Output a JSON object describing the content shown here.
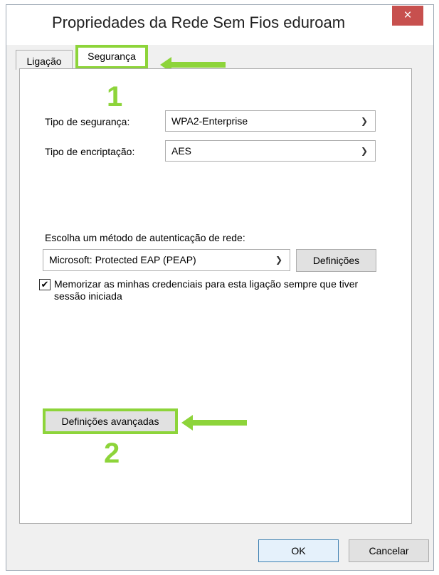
{
  "window": {
    "title": "Propriedades da Rede Sem Fios eduroam",
    "close_symbol": "×"
  },
  "tabs": [
    {
      "label": "Ligação"
    },
    {
      "label": "Segurança"
    }
  ],
  "security_type": {
    "label": "Tipo de segurança:",
    "value": "WPA2-Enterprise"
  },
  "encryption_type": {
    "label": "Tipo de encriptação:",
    "value": "AES"
  },
  "auth_method": {
    "label": "Escolha um método de autenticação de rede:",
    "value": "Microsoft: Protected EAP (PEAP)",
    "settings_label": "Definições"
  },
  "remember_credentials": {
    "checked": true,
    "label": "Memorizar as minhas credenciais para esta ligação sempre que tiver sessão iniciada"
  },
  "advanced_settings_label": "Definições avançadas",
  "annotations": {
    "step1": "1",
    "step2": "2",
    "highlight_color": "#8dd43a"
  },
  "footer": {
    "ok_label": "OK",
    "cancel_label": "Cancelar"
  }
}
